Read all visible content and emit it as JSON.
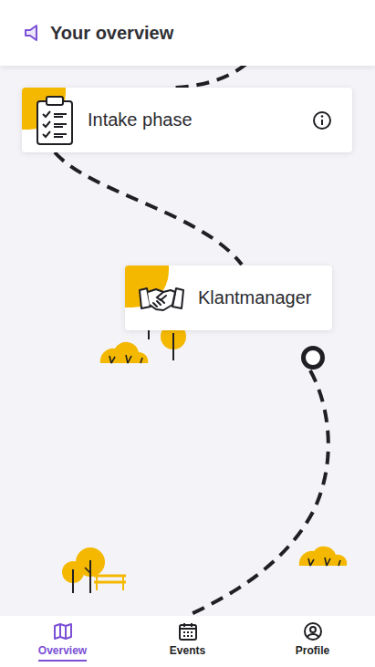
{
  "header": {
    "title": "Your overview"
  },
  "milestones": [
    {
      "label": "Intake phase",
      "kind": "checklist",
      "info": true,
      "current": false
    },
    {
      "label": "Klantmanager",
      "kind": "handshake",
      "info": false,
      "current": true
    }
  ],
  "nav": [
    {
      "label": "Overview",
      "selected": true
    },
    {
      "label": "Events",
      "selected": false
    },
    {
      "label": "Profile",
      "selected": false
    }
  ]
}
